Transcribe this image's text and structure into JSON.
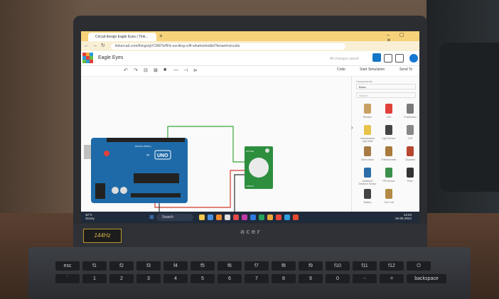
{
  "browser": {
    "tab_title": "Circuit design Eagle Eyes | Tink...",
    "new_tab": "+",
    "window_controls": "–  ▢  ✕",
    "url": "tinkercad.com/things/gVC8WTsHHz-exciting-crift-whatnot/editel?tenant=circuits",
    "nav_back": "←",
    "nav_forward": "→",
    "nav_reload": "↻"
  },
  "app": {
    "logo_letters": [
      "TIN",
      "KER",
      "CAD"
    ],
    "project_title": "Eagle Eyes",
    "saved_status": "All changes saved",
    "code_label": "Code",
    "simulation_label": "Start Simulation",
    "send_label": "Send To"
  },
  "toolbar_icons": [
    "↶",
    "↷",
    "⊟",
    "⊠",
    "■",
    "—",
    "⊣",
    "⊳"
  ],
  "board": {
    "name": "UNO",
    "brand": "∞",
    "label": "DIGITAL (PWM~)"
  },
  "sensor": {
    "label_top": "ACTIVE",
    "label_bottom": "LOW IN"
  },
  "panel": {
    "components_label": "Components",
    "components_value": "Basic",
    "search_placeholder": "Search",
    "items": [
      {
        "label": "Resistor",
        "color": "#c9a063"
      },
      {
        "label": "LED",
        "color": "#e0403a"
      },
      {
        "label": "Pushbutton",
        "color": "#7a7a7a"
      },
      {
        "label": "Incandescent Light Bulb",
        "color": "#e8c34a"
      },
      {
        "label": "Light Sensor",
        "color": "#444444"
      },
      {
        "label": "LDR",
        "color": "#888888"
      },
      {
        "label": "Slide switch",
        "color": "#a67b45"
      },
      {
        "label": "Potentiometer",
        "color": "#a97a3c"
      },
      {
        "label": "Capacitor",
        "color": "#b8472f"
      },
      {
        "label": "Ultrasonic Distance Sensor",
        "color": "#2d6ea8"
      },
      {
        "label": "PIR Sensor",
        "color": "#3a8f4a"
      },
      {
        "label": "Piezo",
        "color": "#333333"
      },
      {
        "label": "Battery",
        "color": "#444444"
      },
      {
        "label": "Coin Cell",
        "color": "#b38a45"
      }
    ]
  },
  "taskbar": {
    "weather_temp": "32°C",
    "weather_desc": "Sunny",
    "search_label": "Search",
    "time": "13:03",
    "date": "26-05-2024",
    "icons": [
      "#f2c94c",
      "#4a90e2",
      "#f28b30",
      "#e0e0e0",
      "#e04a4a",
      "#c13aa8",
      "#2e7be0",
      "#27a35b",
      "#e8a83a",
      "#e8473a",
      "#2e9ee0",
      "#e64a2e"
    ]
  },
  "hardware": {
    "sticker_text": "144Hz",
    "laptop_brand": "acer",
    "keyboard_row1": [
      "esc",
      "f1",
      "f2",
      "f3",
      "f4",
      "f5",
      "f6",
      "f7",
      "f8",
      "f9",
      "f10",
      "f11",
      "f12",
      "⏻"
    ],
    "keyboard_row2": [
      "`",
      "1",
      "2",
      "3",
      "4",
      "5",
      "6",
      "7",
      "8",
      "9",
      "0",
      "-",
      "=",
      "backspace"
    ]
  }
}
